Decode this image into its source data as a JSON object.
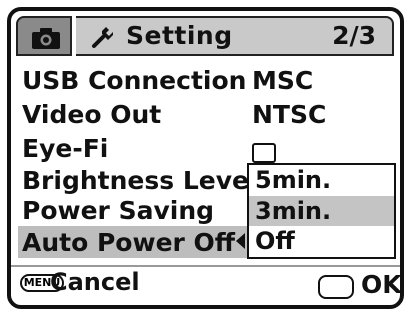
{
  "header": {
    "camera_tab_icon": "camera-icon",
    "setting_tab_icon": "wrench-icon",
    "setting_tab_label": "Setting",
    "page_indicator": "2/3"
  },
  "menu": {
    "items": [
      {
        "label": "USB Connection",
        "value": "MSC"
      },
      {
        "label": "Video Out",
        "value": "NTSC"
      },
      {
        "label": "Eye-Fi",
        "value": "",
        "value_icon": "checkbox-icon"
      },
      {
        "label": "Brightness Level",
        "value": ""
      },
      {
        "label": "Power Saving",
        "value": ""
      },
      {
        "label": "Auto Power Off",
        "value": "",
        "selected": true
      }
    ]
  },
  "dropdown": {
    "options": [
      "5min.",
      "3min.",
      "Off"
    ],
    "selected_index": 1
  },
  "footer": {
    "menu_key_label": "MENU",
    "cancel_label": "Cancel",
    "ok_label": "OK"
  },
  "colors": {
    "highlight": "#c4c4c4",
    "camera_tab": "#8a8a8a",
    "setting_tab": "#c9c9c9",
    "text": "#111111"
  }
}
